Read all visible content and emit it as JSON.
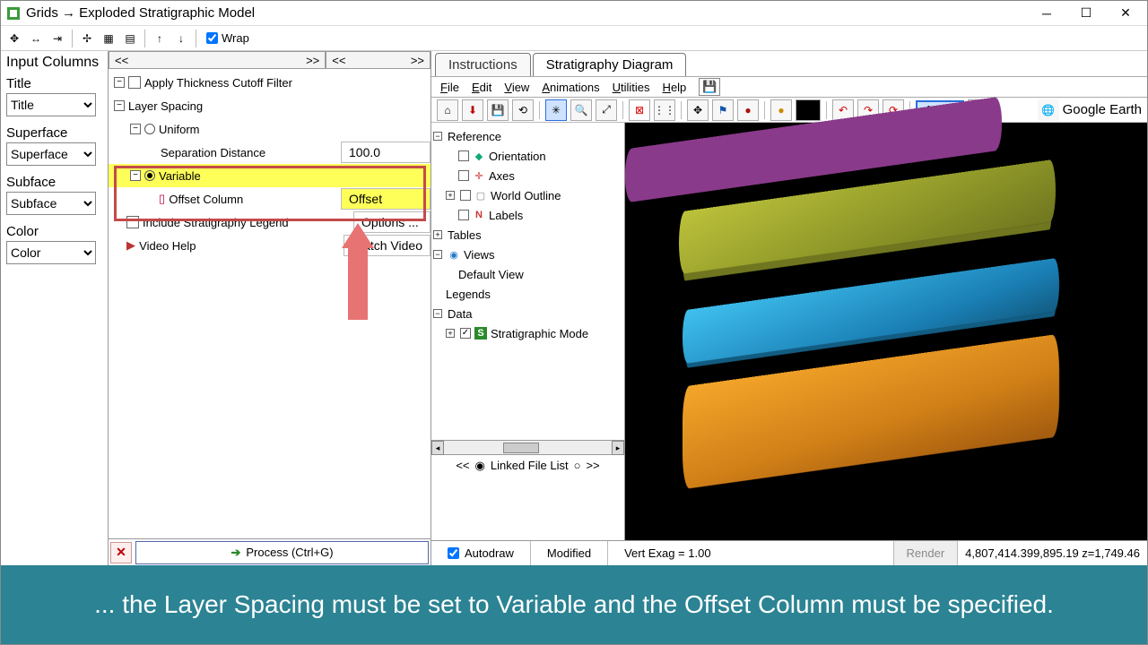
{
  "window": {
    "title": "Grids → Exploded Stratigraphic Model"
  },
  "toolbar": {
    "wrap_label": "Wrap"
  },
  "input_columns": {
    "heading": "Input Columns",
    "title_label": "Title",
    "title_value": "Title",
    "superface_label": "Superface",
    "superface_value": "Superface",
    "subface_label": "Subface",
    "subface_value": "Subface",
    "color_label": "Color",
    "color_value": "Color"
  },
  "tree": {
    "nav_left_back": "<<",
    "nav_left_fwd": ">>",
    "nav_right_back": "<<",
    "nav_right_fwd": ">>",
    "apply_filter": "Apply Thickness Cutoff Filter",
    "layer_spacing": "Layer Spacing",
    "uniform": "Uniform",
    "sep_distance_label": "Separation Distance",
    "sep_distance_value": "100.0",
    "variable": "Variable",
    "offset_col_label": "Offset Column",
    "offset_col_value": "Offset",
    "include_legend": "Include Stratigraphy Legend",
    "include_legend_btn": "Options ...",
    "video_help": "Video Help",
    "video_btn": "Watch Video"
  },
  "process": {
    "label": "Process (Ctrl+G)"
  },
  "tabs": {
    "instructions": "Instructions",
    "diagram": "Stratigraphy Diagram"
  },
  "menu": {
    "file": "File",
    "edit": "Edit",
    "view": "View",
    "animations": "Animations",
    "utilities": "Utilities",
    "help": "Help"
  },
  "vtoolbar": {
    "zoom": "113%",
    "ge": "Google Earth"
  },
  "scene": {
    "reference": "Reference",
    "orientation": "Orientation",
    "axes": "Axes",
    "world_outline": "World Outline",
    "labels": "Labels",
    "tables": "Tables",
    "views": "Views",
    "default_view": "Default View",
    "legends": "Legends",
    "data": "Data",
    "strat_model": "Stratigraphic Mode",
    "linked": "Linked File List"
  },
  "status": {
    "autodraw": "Autodraw",
    "modified": "Modified",
    "vert": "Vert Exag = 1.00",
    "render": "Render",
    "coords": "4,807,414.399,895.19 z=1,749.46"
  },
  "caption": "... the Layer Spacing must be set to Variable and the Offset Column must be specified."
}
